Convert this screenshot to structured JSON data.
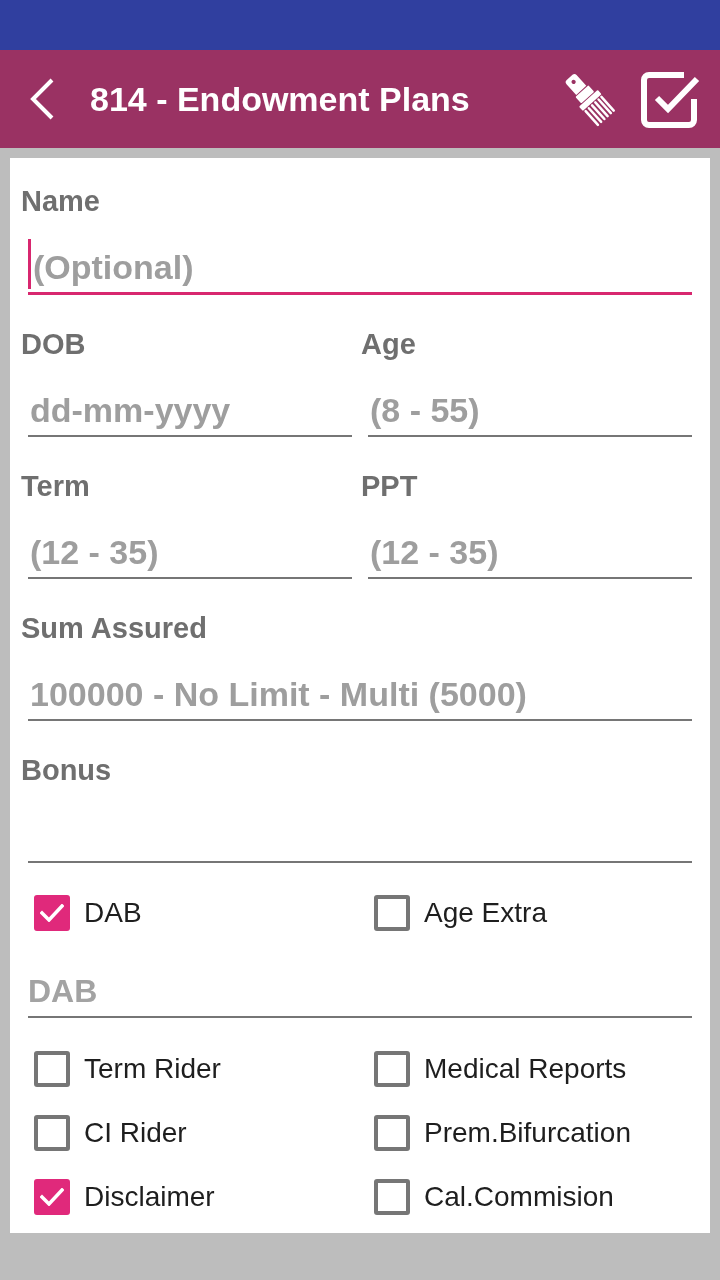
{
  "app_bar": {
    "title": "814 - Endowment Plans"
  },
  "form": {
    "rows": [
      [
        {
          "label": "Name",
          "placeholder": "(Optional)",
          "focused": true
        }
      ],
      [
        {
          "label": "DOB",
          "placeholder": "dd-mm-yyyy",
          "focused": false
        },
        {
          "label": "Age",
          "placeholder": "(8 - 55)",
          "focused": false
        }
      ],
      [
        {
          "label": "Term",
          "placeholder": "(12 - 35)",
          "focused": false
        },
        {
          "label": "PPT",
          "placeholder": "(12 - 35)",
          "focused": false
        }
      ],
      [
        {
          "label": "Sum Assured",
          "placeholder": "100000 - No Limit - Multi (5000)",
          "focused": false
        }
      ],
      [
        {
          "label": "Bonus",
          "focused": false
        }
      ]
    ],
    "options": [
      {
        "label": "DAB",
        "checked": true
      },
      {
        "label": "Age Extra",
        "checked": false
      }
    ],
    "dab_field": {
      "placeholder": "DAB"
    },
    "riders": [
      {
        "label": "Term Rider",
        "checked": false
      },
      {
        "label": "Medical Reports",
        "checked": false
      },
      {
        "label": "CI Rider",
        "checked": false
      },
      {
        "label": "Prem.Bifurcation",
        "checked": false
      },
      {
        "label": "Disclaimer",
        "checked": true
      },
      {
        "label": "Cal.Commision",
        "checked": false
      }
    ]
  }
}
